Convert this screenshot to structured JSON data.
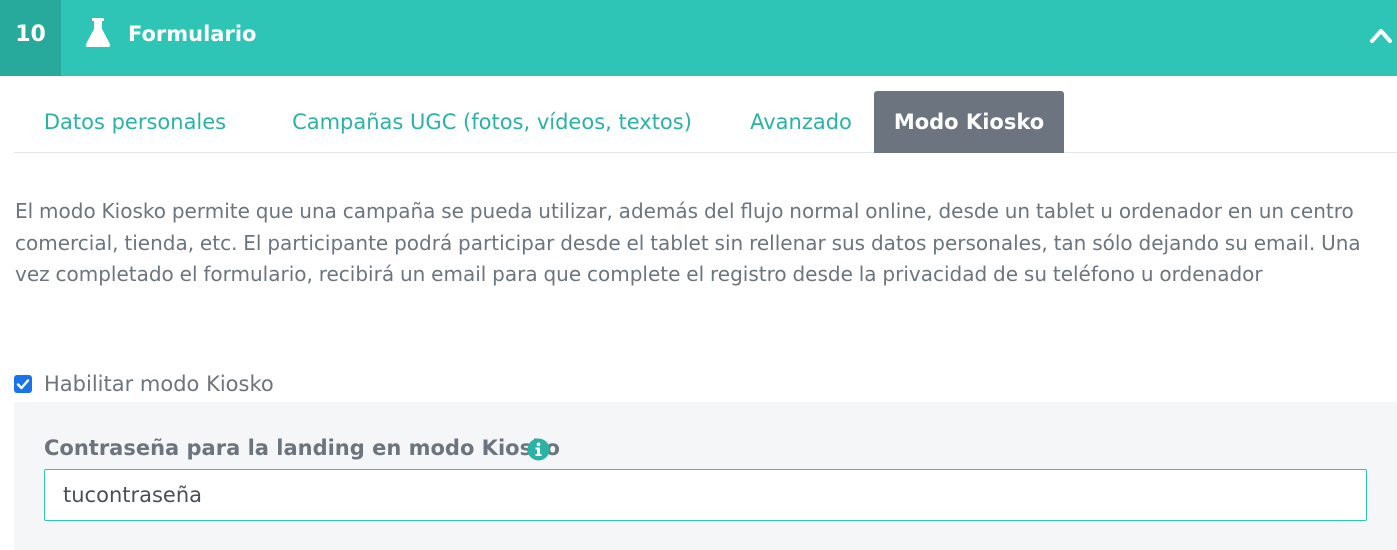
{
  "header": {
    "step_number": "10",
    "title": "Formulario",
    "icon": "flask-icon",
    "collapse_icon": "chevron-up-icon",
    "colors": {
      "bar": "#2ec5b6",
      "step_bg": "#27aa9c"
    }
  },
  "tabs": [
    {
      "label": "Datos personales",
      "active": false
    },
    {
      "label": "Campañas UGC (fotos, vídeos, textos)",
      "active": false
    },
    {
      "label": "Avanzado",
      "active": false
    },
    {
      "label": "Modo Kiosko",
      "active": true
    }
  ],
  "description": "El modo Kiosko permite que una campaña se pueda utilizar, además del flujo normal online, desde un tablet u ordenador en un centro comercial, tienda, etc. El participante podrá participar desde el tablet sin rellenar sus datos personales, tan sólo dejando su email. Una vez completado el formulario, recibirá un email para que complete el registro desde la privacidad de su teléfono u ordenador",
  "enable_kiosk": {
    "label": "Habilitar modo Kiosko",
    "checked": true
  },
  "password_field": {
    "label": "Contraseña para la landing en modo Kiosko",
    "value": "tucontraseña",
    "info_icon": "info-icon"
  }
}
